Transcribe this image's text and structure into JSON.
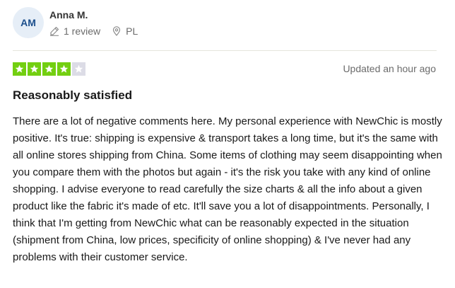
{
  "reviewer": {
    "initials": "AM",
    "name": "Anna M.",
    "review_count": "1 review",
    "country": "PL",
    "icons": {
      "reviews": "pencil-icon",
      "location": "location-pin-icon"
    }
  },
  "review": {
    "rating": 4,
    "max_rating": 5,
    "updated": "Updated an hour ago",
    "title": "Reasonably satisfied",
    "body": "There are a lot of negative comments here. My personal experience with NewChic is mostly positive. It's true: shipping is expensive & transport takes a long time, but it's the same with all online stores shipping from China. Some items of clothing may seem disappointing when you compare them with the photos but again - it's the risk you take with any kind of online shopping. I advise everyone to read carefully the size charts & all the info about a given product like the fabric it's made of etc. It'll save you a lot of disappointments. Personally, I think that I'm getting from NewChic what can be reasonably expected in the situation (shipment from China, low prices, specificity of online shopping) & I've never had any problems with their customer service."
  },
  "colors": {
    "star_filled": "#73cf11",
    "star_empty": "#dcdce6",
    "avatar_bg": "#e6eef7",
    "avatar_text": "#1c4f8c"
  }
}
